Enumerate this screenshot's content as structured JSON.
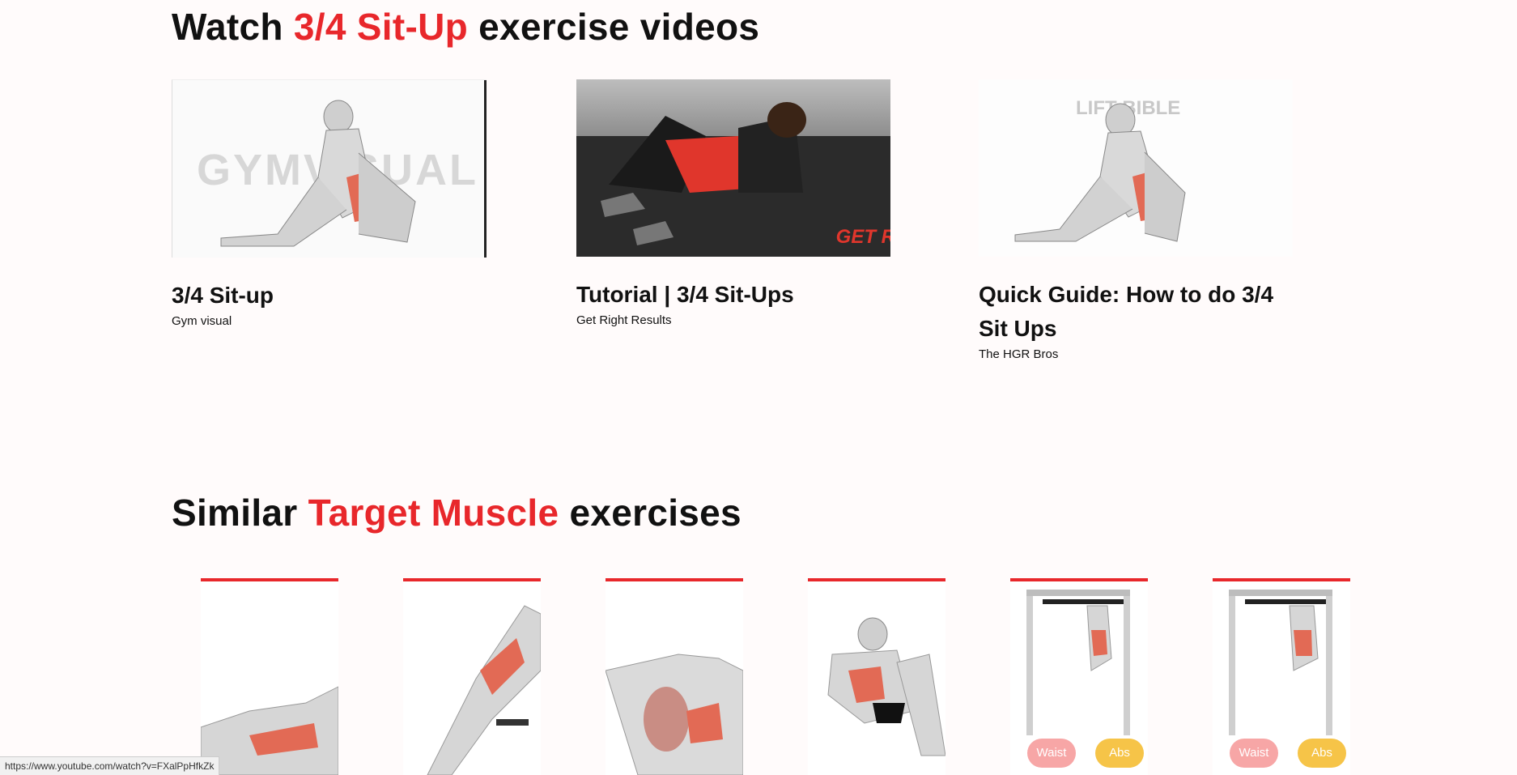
{
  "videos_section": {
    "title_pre": "Watch ",
    "title_highlight": "3/4 Sit-Up",
    "title_post": " exercise videos"
  },
  "videos": [
    {
      "title": "3/4 Sit-up",
      "channel": "Gym visual",
      "watermark": "GYMVISUAL"
    },
    {
      "title": "Tutorial | 3/4 Sit-Ups",
      "channel": "Get Right Results",
      "watermark": "GET R"
    },
    {
      "title": "Quick Guide: How to do 3/4 Sit Ups",
      "channel": "The HGR Bros",
      "watermark": "LIFT BIBLE"
    }
  ],
  "similar_section": {
    "title_pre": "Similar ",
    "title_highlight": "Target Muscle",
    "title_post": " exercises"
  },
  "tags": {
    "waist": "Waist",
    "abs": "Abs"
  },
  "status_bar": {
    "url": "https://www.youtube.com/watch?v=FXalPpHfkZk"
  },
  "colors": {
    "accent": "#e8272b",
    "waist_tag": "#f7a6a6",
    "abs_tag": "#f6c448",
    "background": "#fffbfb"
  }
}
